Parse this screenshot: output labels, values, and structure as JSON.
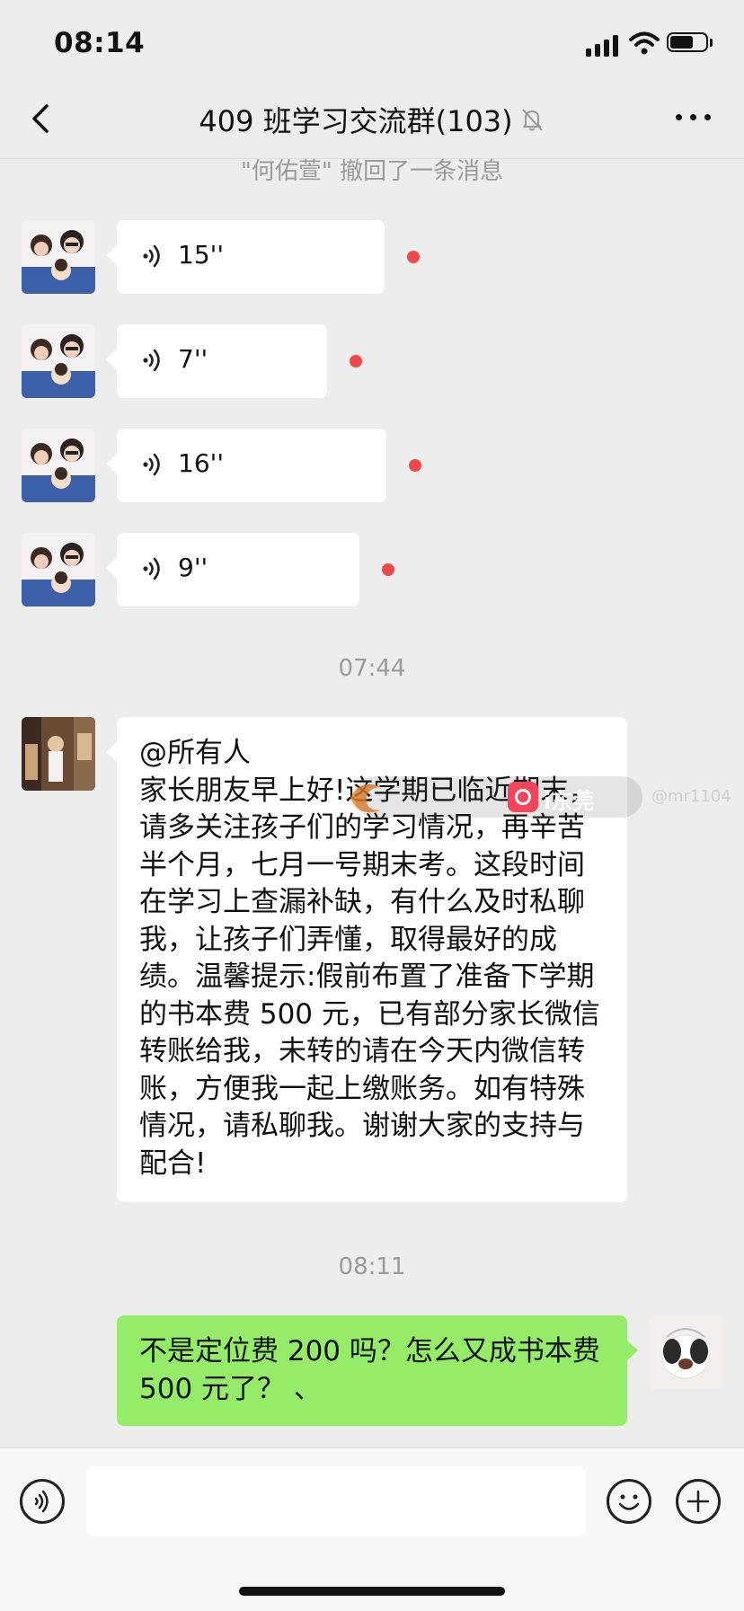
{
  "status_bar": {
    "time": "08:14",
    "battery_level": 0.65
  },
  "header": {
    "title": "409 班学习交流群(103)",
    "muted": true
  },
  "system_message": "\"何佑萱\" 撤回了一条消息",
  "voice_messages": [
    {
      "duration": "15''",
      "unread": true
    },
    {
      "duration": "7''",
      "unread": true
    },
    {
      "duration": "16''",
      "unread": true
    },
    {
      "duration": "9''",
      "unread": true
    }
  ],
  "timestamps": [
    "07:44",
    "08:11"
  ],
  "announcement_text": "@所有人\n家长朋友早上好!这学期已临近期末，请多关注孩子们的学习情况，再辛苦半个月，七月一号期末考。这段时间在学习上查漏补缺，有什么及时私聊我，让孩子们弄懂，取得最好的成绩。温馨提示:假前布置了准备下学期的书本费 500 元，已有部分家长微信转账给我，未转的请在今天内微信转账，方便我一起上缴账务。如有特殊情况，请私聊我。谢谢大家的支持与配合!",
  "reply_text": "不是定位费 200 吗？怎么又成书本费 500 元了？ 、",
  "watermark": {
    "brand": "i东莞",
    "handle": "@mr1104"
  },
  "icons": {
    "back": "chevron-left-icon",
    "mute": "bell-slash-icon",
    "more": "more-dots-icon",
    "voice": "voice-wave-icon",
    "voice_toggle": "voice-toggle-icon",
    "emoji": "emoji-icon",
    "plus": "plus-icon"
  },
  "colors": {
    "background": "#ededed",
    "sent_bubble": "#95ec69",
    "received_bubble": "#ffffff",
    "unread_dot": "#f04848",
    "system_text": "#9a9a9a"
  }
}
